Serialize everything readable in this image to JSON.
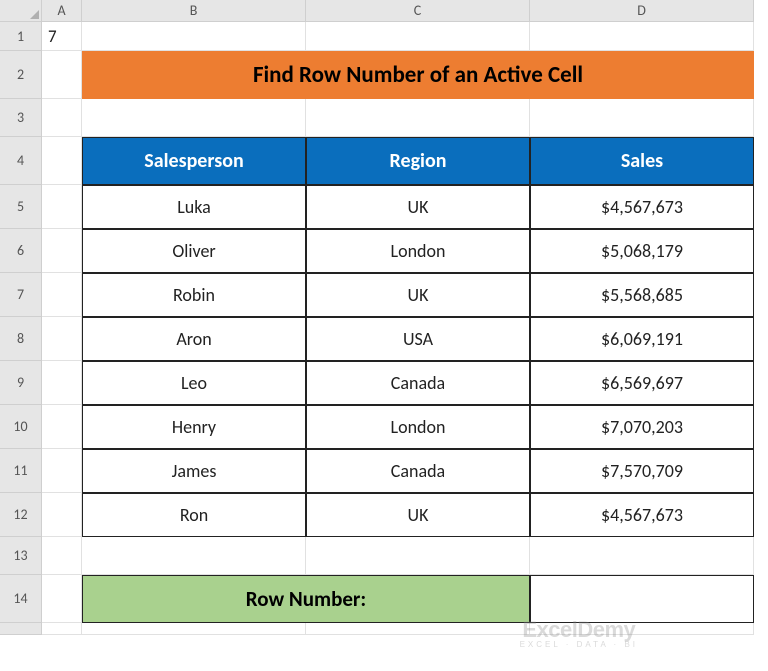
{
  "columns": [
    "A",
    "B",
    "C",
    "D"
  ],
  "rows": [
    "1",
    "2",
    "3",
    "4",
    "5",
    "6",
    "7",
    "8",
    "9",
    "10",
    "11",
    "12",
    "13",
    "14"
  ],
  "cellA1": "7",
  "title": "Find Row Number of an Active Cell",
  "headers": {
    "salesperson": "Salesperson",
    "region": "Region",
    "sales": "Sales"
  },
  "data": [
    {
      "salesperson": "Luka",
      "region": "UK",
      "sales": "$4,567,673"
    },
    {
      "salesperson": "Oliver",
      "region": "London",
      "sales": "$5,068,179"
    },
    {
      "salesperson": "Robin",
      "region": "UK",
      "sales": "$5,568,685"
    },
    {
      "salesperson": "Aron",
      "region": "USA",
      "sales": "$6,069,191"
    },
    {
      "salesperson": "Leo",
      "region": "Canada",
      "sales": "$6,569,697"
    },
    {
      "salesperson": "Henry",
      "region": "London",
      "sales": "$7,070,203"
    },
    {
      "salesperson": "James",
      "region": "Canada",
      "sales": "$7,570,709"
    },
    {
      "salesperson": "Ron",
      "region": "UK",
      "sales": "$4,567,673"
    }
  ],
  "rowNumberLabel": "Row Number:",
  "rowNumberValue": "",
  "watermark": {
    "brand": "ExcelDemy",
    "tagline": "EXCEL · DATA · BI"
  }
}
